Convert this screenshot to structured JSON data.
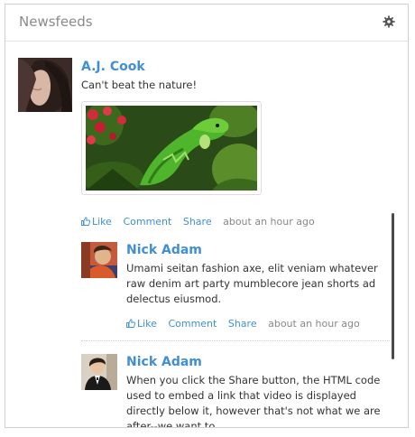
{
  "header": {
    "title": "Newsfeeds",
    "settings_icon": "gear-icon"
  },
  "post": {
    "author": "A.J. Cook",
    "text": "Can't beat the nature!",
    "actions": {
      "like": "Like",
      "comment": "Comment",
      "share": "Share",
      "time": "about an hour ago"
    }
  },
  "comments": [
    {
      "author": "Nick Adam",
      "text": "Umami seitan fashion axe, elit veniam whatever raw denim art party mumblecore jean shorts ad delectus eiusmod.",
      "actions": {
        "like": "Like",
        "comment": "Comment",
        "share": "Share",
        "time": "about an hour ago"
      }
    },
    {
      "author": "Nick Adam",
      "text": "When you click the Share button, the HTML code used to embed a link that video is displayed directly below it, however that's not what we are after--we want to"
    }
  ],
  "colors": {
    "link": "#3f8fd2",
    "text": "#333333",
    "muted": "#888888",
    "border": "#cfcfcf"
  }
}
